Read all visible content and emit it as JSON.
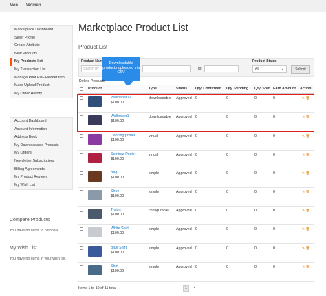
{
  "topnav": {
    "items": [
      "Men",
      "Women"
    ]
  },
  "sidebar": {
    "primary": [
      "Marketplace Dashboard",
      "Seller Profile",
      "Create Attribute",
      "New Products",
      "My Products list",
      "My Transaction List",
      "Manage Print PDF Header Info",
      "Mass Upload Product",
      "My Order History"
    ],
    "active_index": 4,
    "account": [
      "Account Dashboard",
      "Account Information",
      "Address Book",
      "My Downloadable Products",
      "My Orders",
      "Newsletter Subscriptions",
      "Billing Agreements",
      "My Product Reviews",
      "My Wish List"
    ]
  },
  "compare": {
    "title": "Compare Products",
    "text": "You have no items to compare."
  },
  "wishlist": {
    "title": "My Wish List",
    "text": "You have no items in your wish list."
  },
  "page": {
    "title": "Marketplace Product List",
    "subtitle": "Product List"
  },
  "filter": {
    "product_name_label": "Product Name",
    "search_placeholder": "Search by",
    "to_label": "To:",
    "status_label": "Product Status",
    "status_value": "All",
    "submit_label": "Submit"
  },
  "delete_label": "Delete Products",
  "callout": {
    "text": "Downloadable products uploaded via CSV"
  },
  "table": {
    "headers": [
      "Product",
      "Type",
      "Status",
      "Qty. Confirmed",
      "Qty. Pending",
      "Qty. Sold",
      "Earn Amount",
      "Action"
    ],
    "rows": [
      {
        "name": "Wallpaper12",
        "price": "$100.00",
        "type": "downloadable",
        "status": "Approved",
        "confirmed": "0",
        "pending": "0",
        "sold": "0",
        "earn": "0",
        "thumb_color": "#2f4f7a"
      },
      {
        "name": "Wallpaper1",
        "price": "$100.00",
        "type": "downloadable",
        "status": "Approved",
        "confirmed": "0",
        "pending": "0",
        "sold": "0",
        "earn": "0",
        "thumb_color": "#3a3a5a"
      },
      {
        "name": "Dancing poster",
        "price": "$100.00",
        "type": "virtual",
        "status": "Approved",
        "confirmed": "0",
        "pending": "0",
        "sold": "0",
        "earn": "0",
        "thumb_color": "#8a3aa0"
      },
      {
        "name": "Seminar Poster",
        "price": "$100.00",
        "type": "virtual",
        "status": "Approved",
        "confirmed": "0",
        "pending": "0",
        "sold": "0",
        "earn": "0",
        "thumb_color": "#b02040"
      },
      {
        "name": "Bag",
        "price": "$100.00",
        "type": "simple",
        "status": "Approved",
        "confirmed": "0",
        "pending": "0",
        "sold": "0",
        "earn": "0",
        "thumb_color": "#6a3a20"
      },
      {
        "name": "Shoe",
        "price": "$100.00",
        "type": "simple",
        "status": "Approved",
        "confirmed": "0",
        "pending": "0",
        "sold": "0",
        "earn": "0",
        "thumb_color": "#8a9aa8"
      },
      {
        "name": "T-shirt",
        "price": "$100.00",
        "type": "configurable",
        "status": "Approved",
        "confirmed": "0",
        "pending": "0",
        "sold": "0",
        "earn": "0",
        "thumb_color": "#4a5a6a"
      },
      {
        "name": "White Shirt",
        "price": "$100.00",
        "type": "simple",
        "status": "Approved",
        "confirmed": "0",
        "pending": "0",
        "sold": "0",
        "earn": "0",
        "thumb_color": "#c8ccd0"
      },
      {
        "name": "Blue Shirt",
        "price": "$100.00",
        "type": "simple",
        "status": "Approved",
        "confirmed": "0",
        "pending": "0",
        "sold": "0",
        "earn": "0",
        "thumb_color": "#3a5a9a"
      },
      {
        "name": "Shirt",
        "price": "$100.00",
        "type": "simple",
        "status": "Approved",
        "confirmed": "0",
        "pending": "0",
        "sold": "0",
        "earn": "0",
        "thumb_color": "#4a6a8a"
      }
    ]
  },
  "pager": {
    "summary": "Items 1 to 10 of 11 total",
    "pages": [
      "1",
      "2"
    ],
    "current": "1"
  },
  "colors": {
    "accent": "#ff5501",
    "link": "#1979c3",
    "highlight": "#e02020",
    "callout": "#2a8ce8"
  }
}
